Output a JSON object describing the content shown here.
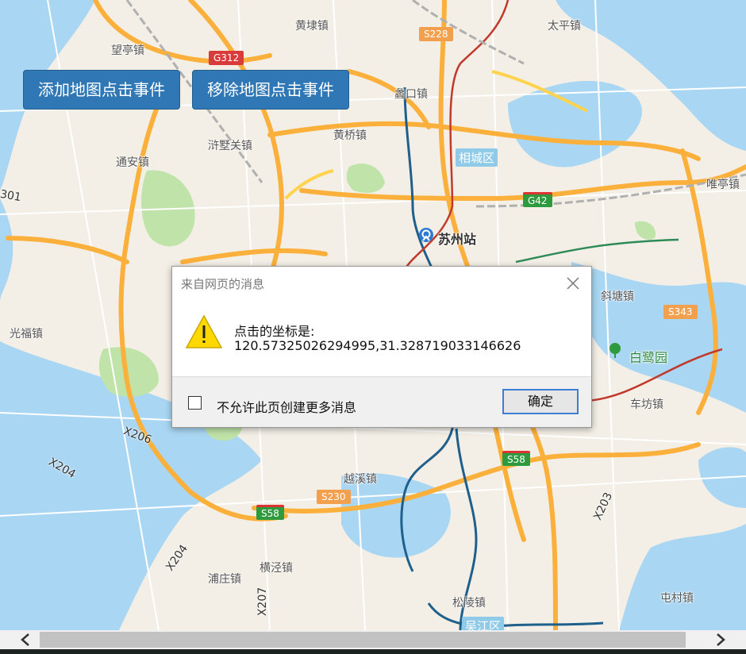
{
  "buttons": {
    "add": "添加地图点击事件",
    "remove": "移除地图点击事件"
  },
  "places": [
    {
      "key": "huangdai",
      "label": "黄埭镇"
    },
    {
      "key": "taiping",
      "label": "太平镇"
    },
    {
      "key": "wangting",
      "label": "望亭镇"
    },
    {
      "key": "likou",
      "label": "蠡口镇"
    },
    {
      "key": "huangqiao",
      "label": "黄桥镇"
    },
    {
      "key": "xushuguan",
      "label": "浒墅关镇"
    },
    {
      "key": "tongan",
      "label": "通安镇"
    },
    {
      "key": "weiting",
      "label": "唯亭镇"
    },
    {
      "key": "guangfu",
      "label": "光福镇"
    },
    {
      "key": "xietang",
      "label": "斜塘镇"
    },
    {
      "key": "chefang",
      "label": "车坊镇"
    },
    {
      "key": "yuexi",
      "label": "越溪镇"
    },
    {
      "key": "puzhuang",
      "label": "浦庄镇"
    },
    {
      "key": "hengjing",
      "label": "横泾镇"
    },
    {
      "key": "songling",
      "label": "松陵镇"
    },
    {
      "key": "tuncun",
      "label": "屯村镇"
    }
  ],
  "landmarks": {
    "station": "苏州站",
    "park": "白鹭园",
    "xiangcheng": "相城区",
    "wujiang": "吴江区"
  },
  "shields": {
    "g312": "G312",
    "s228": "S228",
    "g42": "G42",
    "s343": "S343",
    "s58a": "S58",
    "s58b": "S58",
    "s230": "S230",
    "x206": "X206",
    "x204a": "X204",
    "x204b": "X204",
    "x207": "X207",
    "x203": "X203",
    "r301": "301"
  },
  "dialog": {
    "title": "来自网页的消息",
    "message_line1": "点击的坐标是:",
    "message_line2": "120.57325026294995,31.328719033146626",
    "checkbox_label": "不允许此页创建更多消息",
    "ok_label": "确定",
    "checkbox_checked": false
  },
  "icons": {
    "close": "close-icon",
    "warning": "warning-icon",
    "scroll_left": "chevron-left-icon",
    "scroll_right": "chevron-right-icon",
    "station": "train-station-icon",
    "park": "tree-icon"
  },
  "colors": {
    "button": "#2f78b5",
    "water": "#a9d6f3",
    "land": "#f3efe6",
    "highway": "#fbb03b"
  }
}
